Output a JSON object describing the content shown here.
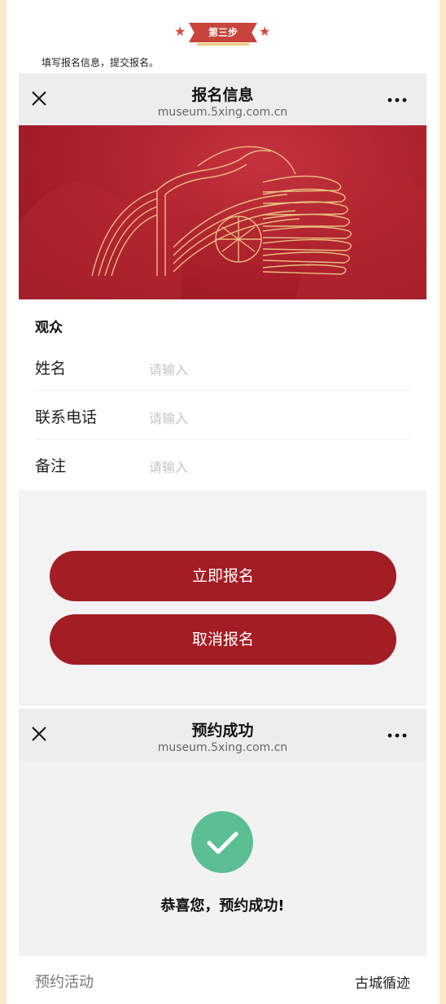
{
  "step": {
    "label": "第三步",
    "instruction": "填写报名信息，提交报名。"
  },
  "registration_page": {
    "title": "报名信息",
    "url": "museum.5xing.com.cn",
    "section_title": "观众",
    "fields": [
      {
        "label": "姓名",
        "placeholder": "请输入"
      },
      {
        "label": "联系电话",
        "placeholder": "请输入"
      },
      {
        "label": "备注",
        "placeholder": "请输入"
      }
    ],
    "submit_label": "立即报名",
    "cancel_label": "取消报名"
  },
  "success_page": {
    "title": "预约成功",
    "url": "museum.5xing.com.cn",
    "message": "恭喜您，预约成功!",
    "info": {
      "label": "预约活动",
      "value": "古城循迹"
    }
  },
  "colors": {
    "primary_red": "#a31d25",
    "success_green": "#5cbf93",
    "side_border": "#fbe8c8"
  },
  "icons": [
    "close-icon",
    "more-icon",
    "star-icon",
    "check-icon"
  ]
}
